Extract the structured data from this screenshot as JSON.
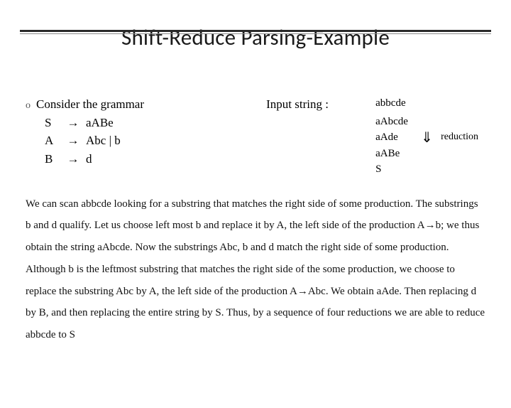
{
  "title": "Shift-Reduce Parsing-Example",
  "grammar": {
    "intro": "Consider the grammar",
    "arrow": "→",
    "prods": [
      {
        "lhs": "S",
        "rhs": "aABe"
      },
      {
        "lhs": "A",
        "rhs": "Abc | b"
      },
      {
        "lhs": "B",
        "rhs": "d"
      }
    ]
  },
  "input": {
    "label": "Input string :",
    "steps": [
      {
        "val": "abbcde",
        "arrow": "",
        "note": ""
      },
      {
        "val": "aAbcde",
        "arrow": "",
        "note": ""
      },
      {
        "val": "aAde",
        "arrow": "⇓",
        "note": "reduction"
      },
      {
        "val": "aABe",
        "arrow": "",
        "note": ""
      },
      {
        "val": "S",
        "arrow": "",
        "note": ""
      }
    ]
  },
  "paragraph": "We can scan abbcde looking for a substring that matches the right side of some production. The substrings b and d qualify. Let us choose left most b and replace it by A, the left side of the production A→b; we thus obtain the string aAbcde. Now the substrings Abc, b and d match the right side of some production. Although b is the leftmost substring that matches the right side of the some production, we choose to replace the substring Abc by A, the left side of the production A→Abc. We obtain aAde. Then replacing d by B, and then replacing the entire string by S. Thus, by a sequence of four reductions we are able to reduce abbcde to S"
}
